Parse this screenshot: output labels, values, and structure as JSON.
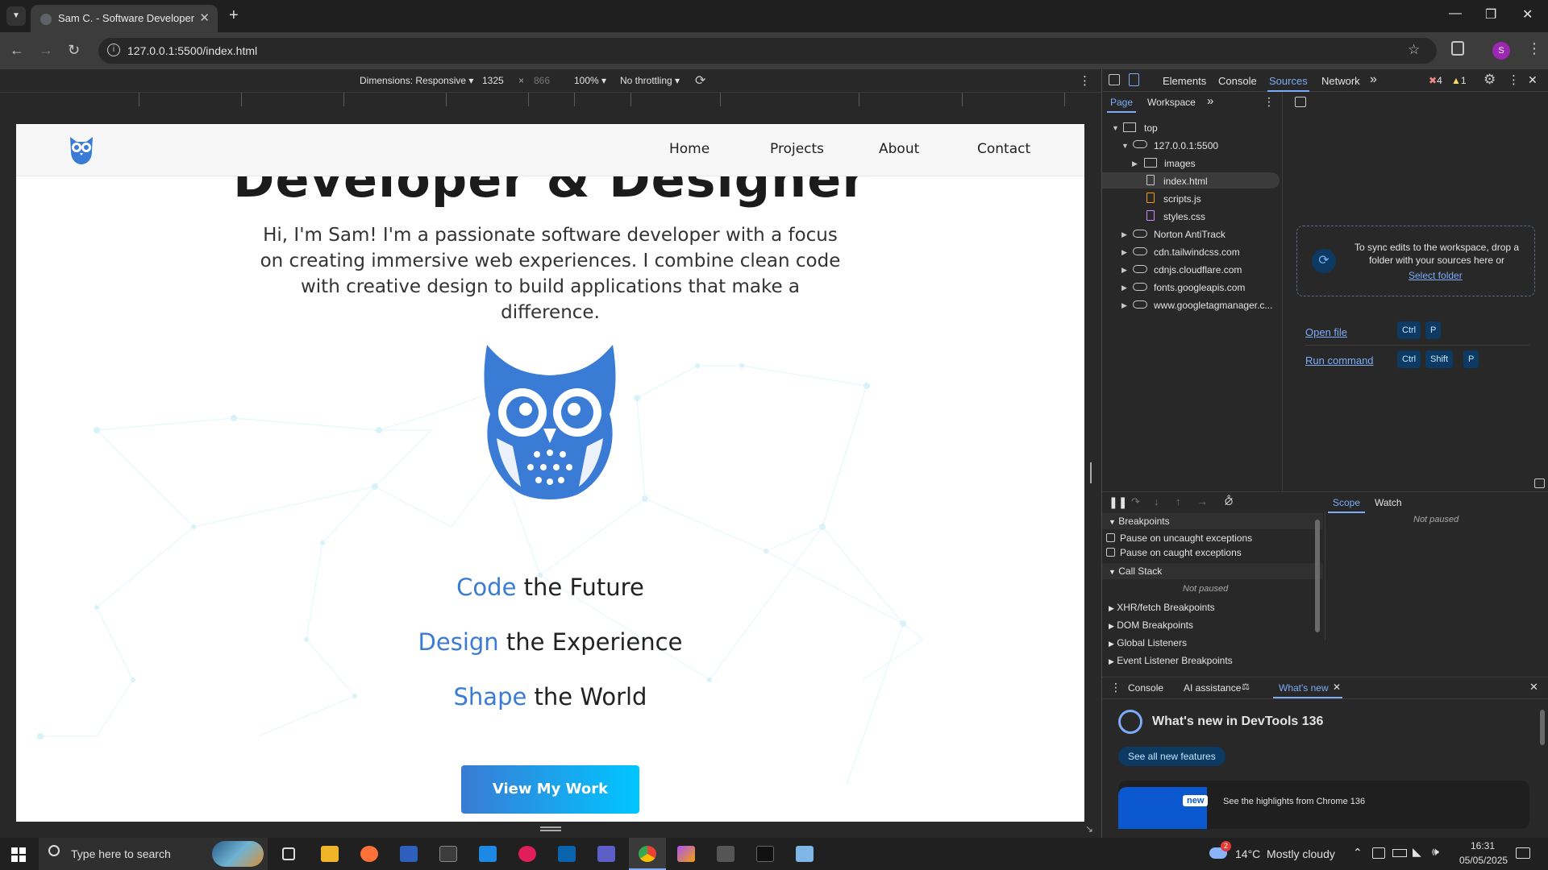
{
  "browser": {
    "tab_title": "Sam C. - Software Developer Po",
    "url": "127.0.0.1:5500/index.html"
  },
  "device_toolbar": {
    "dimensions_label": "Dimensions: Responsive",
    "width": "1325",
    "times": "×",
    "height": "866",
    "zoom": "100%",
    "throttling": "No throttling"
  },
  "site": {
    "nav": [
      "Home",
      "Projects",
      "About",
      "Contact"
    ],
    "hero_title": "Developer & Designer",
    "hero_text": "Hi, I'm Sam! I'm a passionate software developer with a focus on creating immersive web experiences. I combine clean code with creative design to build applications that make a difference.",
    "taglines": [
      {
        "accent": "Code",
        "rest": " the Future"
      },
      {
        "accent": "Design",
        "rest": " the Experience"
      },
      {
        "accent": "Shape",
        "rest": " the World"
      }
    ],
    "cta": "View My Work",
    "accent_color": "#3a7bd5"
  },
  "devtools": {
    "tabs": [
      "Elements",
      "Console",
      "Sources",
      "Network"
    ],
    "active_tab": "Sources",
    "errors": "4",
    "warnings": "1",
    "nav_tabs": [
      "Page",
      "Workspace"
    ],
    "tree": {
      "top": "top",
      "host": "127.0.0.1:5500",
      "folder": "images",
      "files": [
        "index.html",
        "scripts.js",
        "styles.css"
      ],
      "domains": [
        "Norton AntiTrack",
        "cdn.tailwindcss.com",
        "cdnjs.cloudflare.com",
        "fonts.googleapis.com",
        "www.googletagmanager.c..."
      ]
    },
    "sync_text": "To sync edits to the workspace, drop a folder with your sources here or",
    "select_folder": "Select folder",
    "open_file": "Open file",
    "run_command": "Run command",
    "keys": {
      "ctrl": "Ctrl",
      "p": "P",
      "shift": "Shift"
    },
    "breakpoints": {
      "header": "Breakpoints",
      "uncaught": "Pause on uncaught exceptions",
      "caught": "Pause on caught exceptions",
      "call_stack": "Call Stack",
      "not_paused": "Not paused",
      "sections": [
        "XHR/fetch Breakpoints",
        "DOM Breakpoints",
        "Global Listeners",
        "Event Listener Breakpoints"
      ]
    },
    "scope_tabs": [
      "Scope",
      "Watch"
    ],
    "scope_not_paused": "Not paused",
    "drawer_tabs": [
      "Console",
      "AI assistance",
      "What's new"
    ],
    "whats_new_title": "What's new in DevTools 136",
    "see_all": "See all new features",
    "new_badge": "new",
    "highlights": "See the highlights from Chrome 136"
  },
  "taskbar": {
    "search_placeholder": "Type here to search",
    "weather": "14°C  Mostly cloudy",
    "weather_badge": "2",
    "time": "16:31",
    "date": "05/05/2025"
  }
}
